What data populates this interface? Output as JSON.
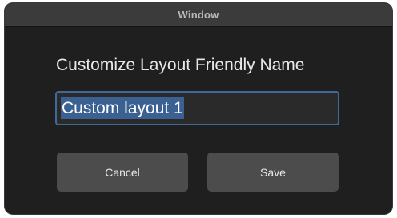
{
  "window": {
    "title": "Window"
  },
  "dialog": {
    "heading": "Customize Layout Friendly Name",
    "name_field_value": "Custom layout 1",
    "cancel_label": "Cancel",
    "save_label": "Save"
  },
  "colors": {
    "window_bg": "#1f1f1f",
    "titlebar_bg": "#3b3b3b",
    "selection_highlight": "#3a6192",
    "focus_ring": "#3f6a97",
    "button_bg": "#4c4c4c"
  }
}
